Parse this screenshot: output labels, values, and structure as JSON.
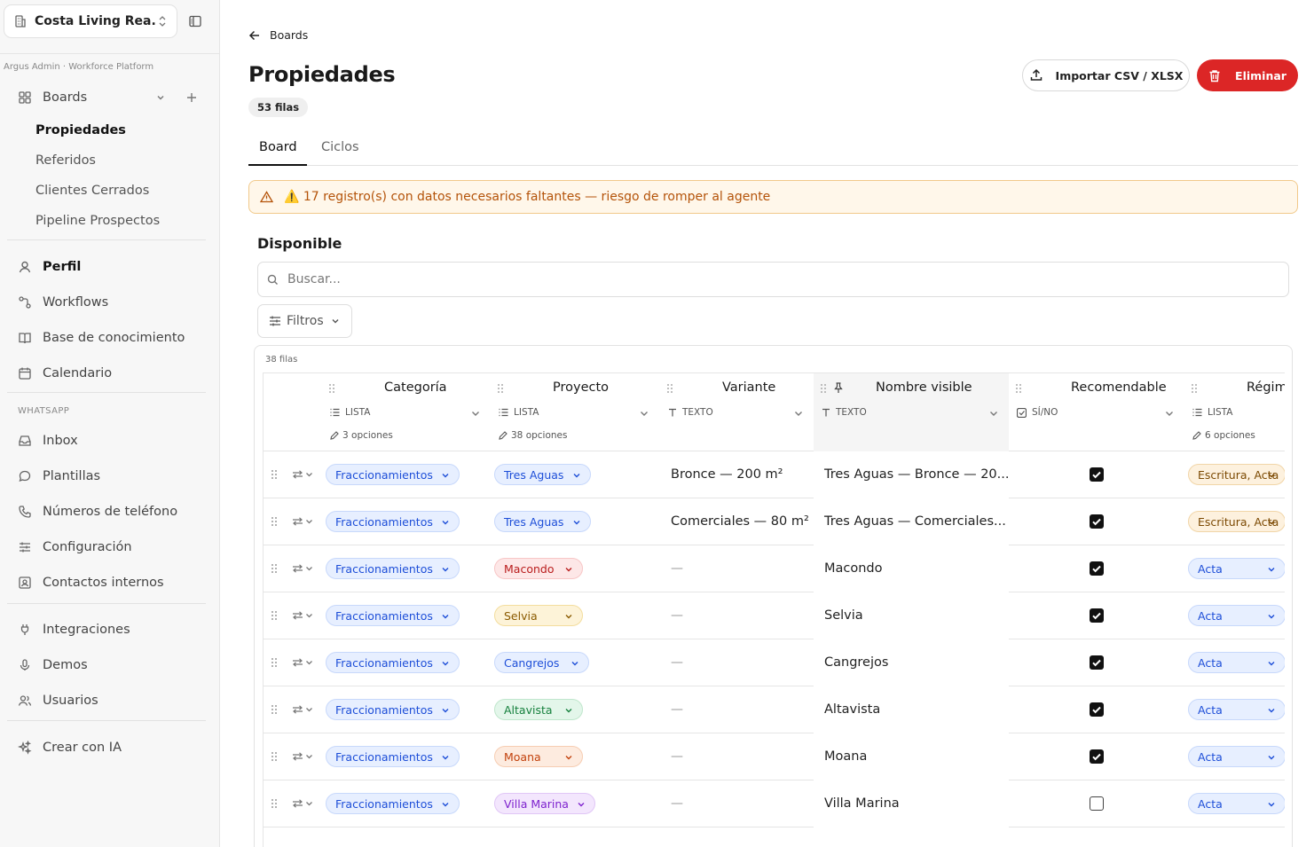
{
  "workspace": {
    "name": "Costa Living Rea..."
  },
  "sidebar": {
    "caption": "Argus Admin · Workforce Platform",
    "boards_label": "Boards",
    "boards": [
      {
        "label": "Propiedades",
        "active": true
      },
      {
        "label": "Referidos"
      },
      {
        "label": "Clientes Cerrados"
      },
      {
        "label": "Pipeline Prospectos"
      }
    ],
    "group1": [
      {
        "label": "Perfil",
        "icon": "user-icon",
        "active": true
      },
      {
        "label": "Workflows",
        "icon": "workflow-icon"
      },
      {
        "label": "Base de conocimiento",
        "icon": "book-icon"
      },
      {
        "label": "Calendario",
        "icon": "calendar-icon"
      }
    ],
    "whatsapp_label": "WHATSAPP",
    "group2": [
      {
        "label": "Inbox",
        "icon": "inbox-icon"
      },
      {
        "label": "Plantillas",
        "icon": "message-icon"
      },
      {
        "label": "Números de teléfono",
        "icon": "phone-icon"
      },
      {
        "label": "Configuración",
        "icon": "sliders-icon"
      },
      {
        "label": "Contactos internos",
        "icon": "contact-icon"
      }
    ],
    "group3": [
      {
        "label": "Integraciones",
        "icon": "plug-icon"
      },
      {
        "label": "Demos",
        "icon": "mic-icon"
      },
      {
        "label": "Usuarios",
        "icon": "users-icon"
      }
    ],
    "ai_label": "Crear con IA"
  },
  "header": {
    "back_label": "Boards",
    "title": "Propiedades",
    "rows_badge": "53 filas",
    "import_label": "Importar CSV / XLSX",
    "delete_label": "Eliminar"
  },
  "tabs": [
    {
      "label": "Board",
      "active": true
    },
    {
      "label": "Ciclos"
    }
  ],
  "alert": "⚠️ 17 registro(s) con datos necesarios faltantes — riesgo de romper al agente",
  "section": {
    "title": "Disponible",
    "search_placeholder": "Buscar...",
    "filters_label": "Filtros",
    "rows_caption": "38 filas"
  },
  "columns": [
    {
      "title": "Categoría",
      "type": "LISTA",
      "options": "3 opciones"
    },
    {
      "title": "Proyecto",
      "type": "LISTA",
      "options": "38 opciones"
    },
    {
      "title": "Variante",
      "type": "TEXTO",
      "options": ""
    },
    {
      "title": "Nombre visible",
      "type": "TEXTO",
      "options": ""
    },
    {
      "title": "Recomendable",
      "type": "SÍ/NO",
      "options": ""
    },
    {
      "title": "Régim",
      "type": "LISTA",
      "options": "6 opciones"
    }
  ],
  "colors": {
    "accent_danger": "#dc2626",
    "alert_bg": "#fff7ea",
    "alert_text": "#b45309"
  },
  "rows": [
    {
      "categoria": "Fraccionamientos",
      "proyecto": "Tres Aguas",
      "proyecto_color": "blue",
      "variante": "Bronce — 200 m²",
      "nombre": "Tres Aguas — Bronce — 20...",
      "recomendable": true,
      "regimen": "Escritura, Acta",
      "regimen_color": "amber"
    },
    {
      "categoria": "Fraccionamientos",
      "proyecto": "Tres Aguas",
      "proyecto_color": "blue",
      "variante": "Comerciales — 80 m²",
      "nombre": "Tres Aguas — Comerciales...",
      "recomendable": true,
      "regimen": "Escritura, Acta",
      "regimen_color": "amber"
    },
    {
      "categoria": "Fraccionamientos",
      "proyecto": "Macondo",
      "proyecto_color": "red",
      "variante": "—",
      "nombre": "Macondo",
      "recomendable": true,
      "regimen": "Acta",
      "regimen_color": "blue"
    },
    {
      "categoria": "Fraccionamientos",
      "proyecto": "Selvia",
      "proyecto_color": "yellow",
      "variante": "—",
      "nombre": "Selvia",
      "recomendable": true,
      "regimen": "Acta",
      "regimen_color": "blue"
    },
    {
      "categoria": "Fraccionamientos",
      "proyecto": "Cangrejos",
      "proyecto_color": "blue",
      "variante": "—",
      "nombre": "Cangrejos",
      "recomendable": true,
      "regimen": "Acta",
      "regimen_color": "blue"
    },
    {
      "categoria": "Fraccionamientos",
      "proyecto": "Altavista",
      "proyecto_color": "green",
      "variante": "—",
      "nombre": "Altavista",
      "recomendable": true,
      "regimen": "Acta",
      "regimen_color": "blue"
    },
    {
      "categoria": "Fraccionamientos",
      "proyecto": "Moana",
      "proyecto_color": "orange",
      "variante": "—",
      "nombre": "Moana",
      "recomendable": true,
      "regimen": "Acta",
      "regimen_color": "blue"
    },
    {
      "categoria": "Fraccionamientos",
      "proyecto": "Villa Marina",
      "proyecto_color": "purple",
      "variante": "—",
      "nombre": "Villa Marina",
      "recomendable": false,
      "regimen": "Acta",
      "regimen_color": "blue"
    }
  ]
}
